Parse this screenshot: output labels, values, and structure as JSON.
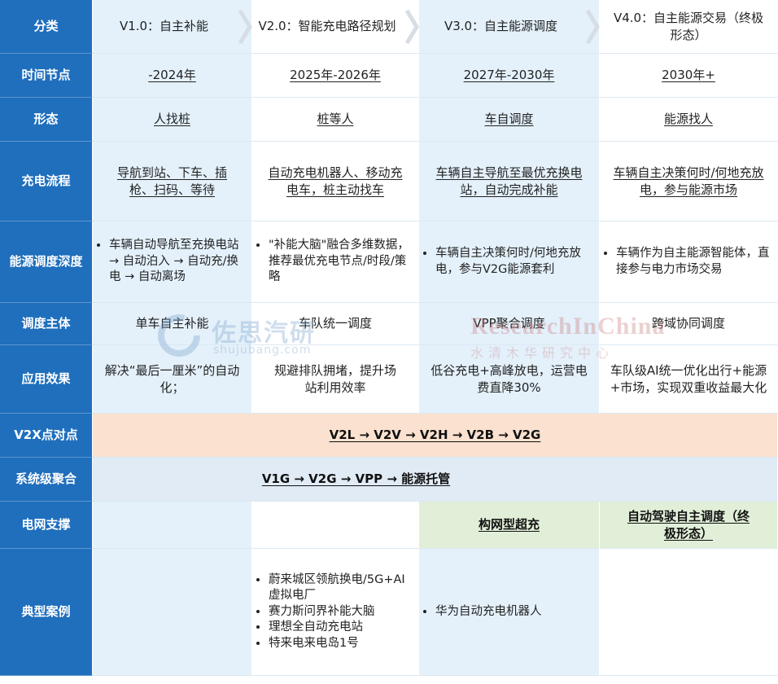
{
  "row_headers": [
    "分类",
    "时间节点",
    "形态",
    "充电流程",
    "能源调度深度",
    "调度主体",
    "应用效果",
    "V2X点对点",
    "系统级聚合",
    "电网支撑",
    "典型案例"
  ],
  "versions": [
    {
      "title": "V1.0：自主补能",
      "time": "-2024年",
      "form": "人找桩",
      "flow": "导航到站、下车、插枪、扫码、等待",
      "depth": "车辆自动导航至充换电站 → 自动泊入 → 自动充/换电 → 自动离场",
      "subject": "单车自主补能",
      "effect": "解决“最后一厘米”的自动化；",
      "grid": "",
      "cases": []
    },
    {
      "title": "V2.0：智能充电路径规划",
      "time": "2025年-2026年",
      "form": "桩等人",
      "flow": "自动充电机器人、移动充电车，桩主动找车",
      "depth": "\"补能大脑\"融合多维数据，推荐最优充电节点/时段/策略",
      "subject": "车队统一调度",
      "effect": "规避排队拥堵，提升场站利用效率",
      "grid": "",
      "cases": [
        "蔚来城区领航换电/5G+AI虚拟电厂",
        "赛力斯问界补能大脑",
        "理想全自动充电站",
        "特来电来电岛1号"
      ]
    },
    {
      "title": "V3.0：自主能源调度",
      "time": "2027年-2030年",
      "form": "车自调度",
      "flow": "车辆自主导航至最优充换电站，自动完成补能",
      "depth": "车辆自主决策何时/何地充放电，参与V2G能源套利",
      "subject": "VPP聚合调度",
      "effect": "低谷充电+高峰放电，运营电费直降30%",
      "grid": "构网型超充",
      "cases": [
        "华为自动充电机器人"
      ]
    },
    {
      "title": "V4.0：自主能源交易（终极形态）",
      "time": "2030年+",
      "form": "能源找人",
      "flow": "车辆自主决策何时/何地充放电，参与能源市场",
      "depth": "车辆作为自主能源智能体，直接参与电力市场交易",
      "subject": "跨域协同调度",
      "effect": "车队级AI统一优化出行+能源+市场，实现双重收益最大化",
      "grid": "自动驾驶自主调度（终极形态）",
      "cases": []
    }
  ],
  "v2x": "V2L → V2V → V2H → V2B → V2G",
  "system": "V1G → V2G → VPP → 能源托管",
  "watermarks": {
    "zuosi": "佐思汽研",
    "zuosi_url": "shujubang.com",
    "ric": "ResearchInChina",
    "ric_cn": "水清木华研究中心"
  },
  "colors": {
    "header_blue": "#1f6fbd",
    "light_blue": "#e4f1fb",
    "v2x_orange": "#fbe1cf",
    "system_blue": "#e1ebf5",
    "grid_green": "#e1efd8"
  }
}
